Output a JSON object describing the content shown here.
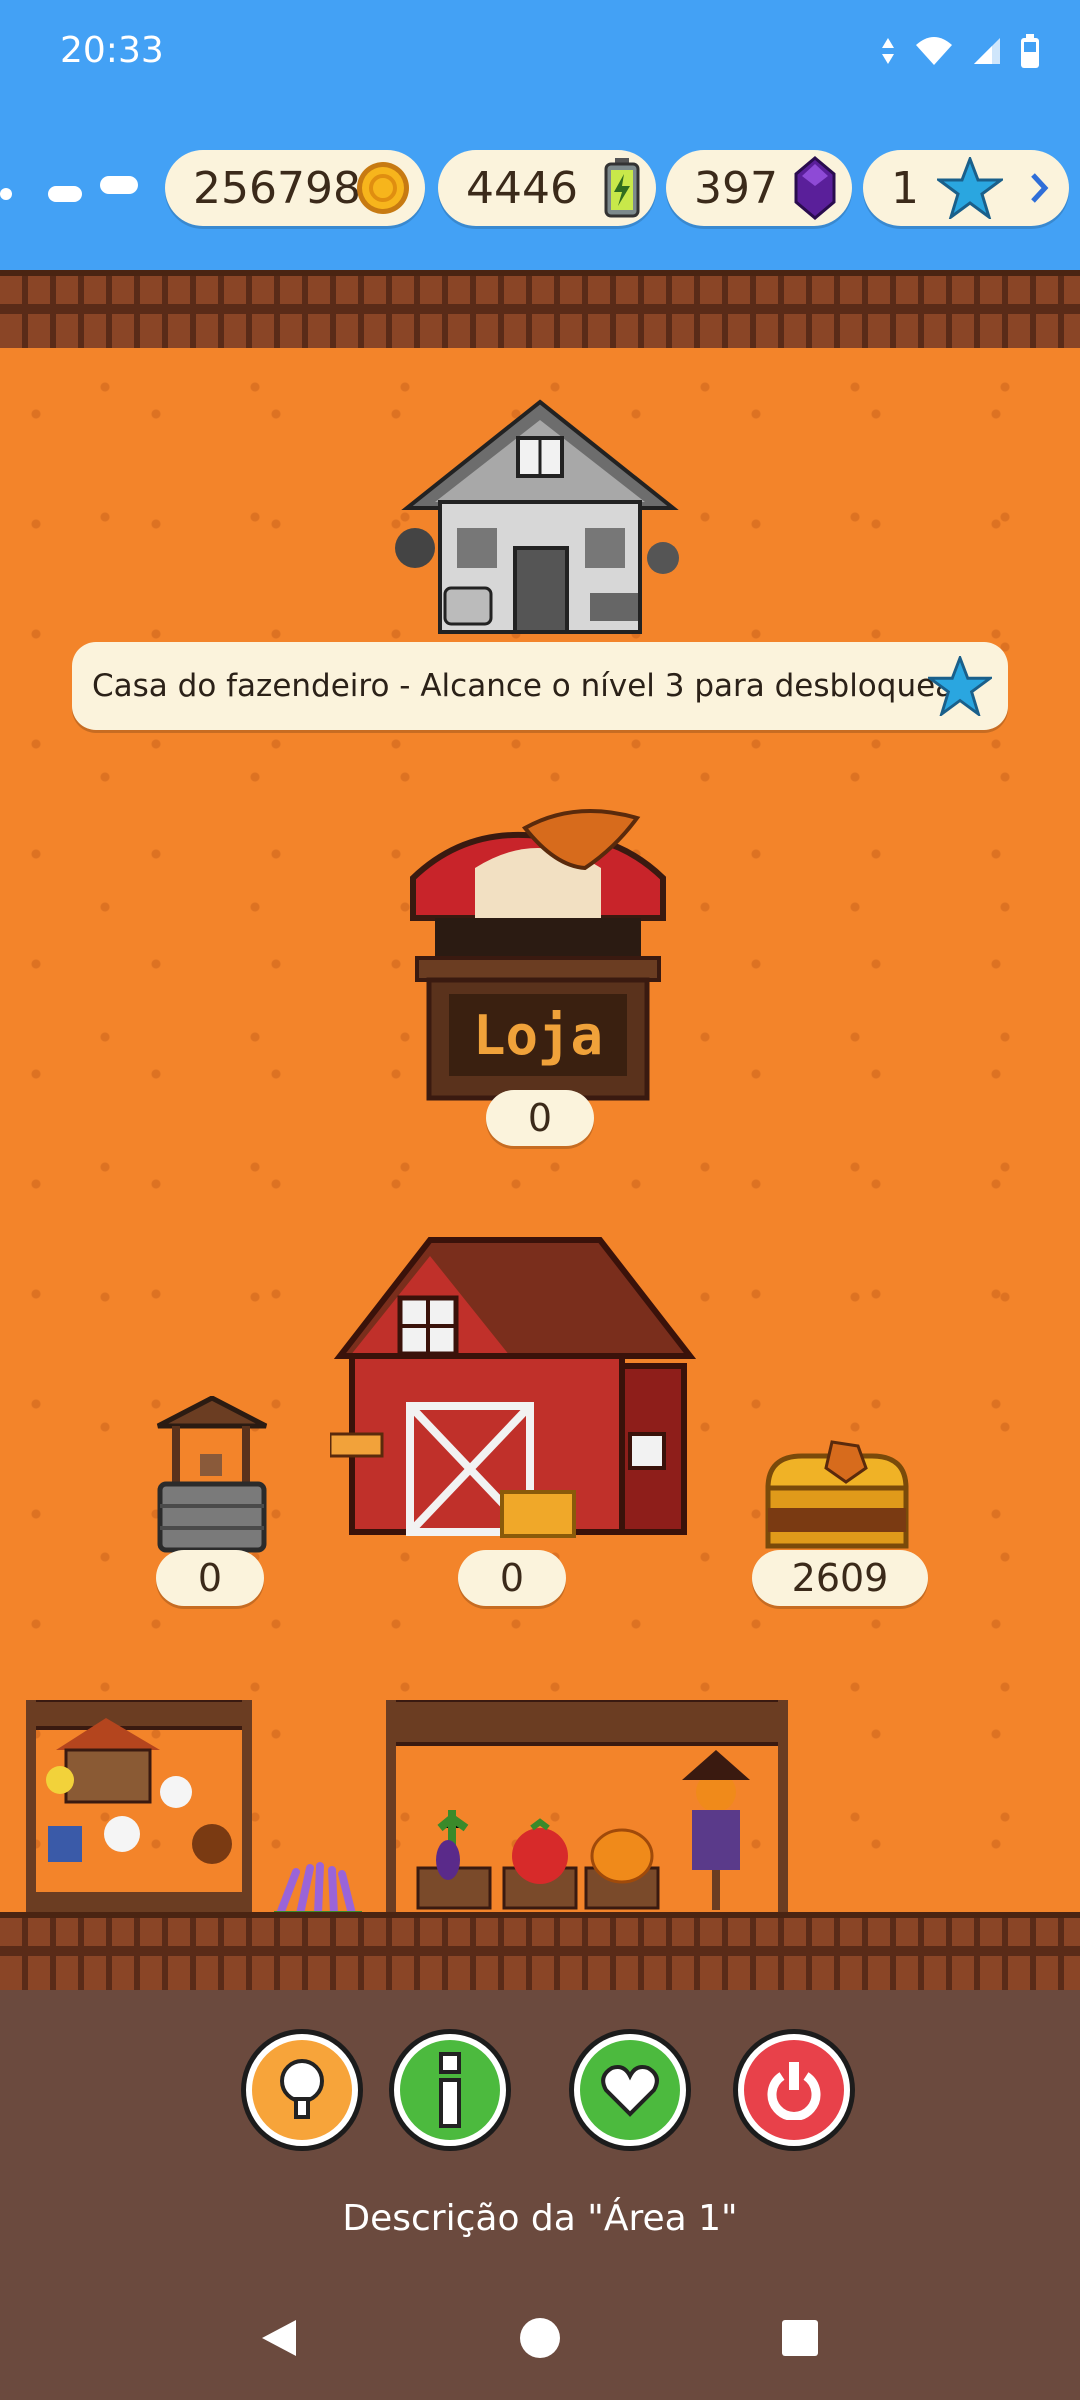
{
  "status": {
    "time": "20:33"
  },
  "resources": {
    "coins": "256798",
    "energy": "4446",
    "gems": "397",
    "stars": "1"
  },
  "farmhouse": {
    "locked_message": "Casa do fazendeiro - Alcance o nível 3 para desbloquear."
  },
  "shop": {
    "sign": "Loja",
    "count": "0"
  },
  "well": {
    "count": "0"
  },
  "barn": {
    "count": "0"
  },
  "chest": {
    "count": "2609"
  },
  "actions": {
    "hint": "hint-icon",
    "info": "info-icon",
    "favorite": "heart-icon",
    "power": "power-icon"
  },
  "description": "Descrição da \"Área 1\"",
  "colors": {
    "sky": "#43a1f5",
    "field": "#f3842a",
    "panel": "#6b4a3e",
    "pill": "#fbf3dc",
    "hint_button": "#f7a43a",
    "info_button": "#4cba3e",
    "favorite_button": "#4cba3e",
    "power_button": "#e8414a"
  }
}
